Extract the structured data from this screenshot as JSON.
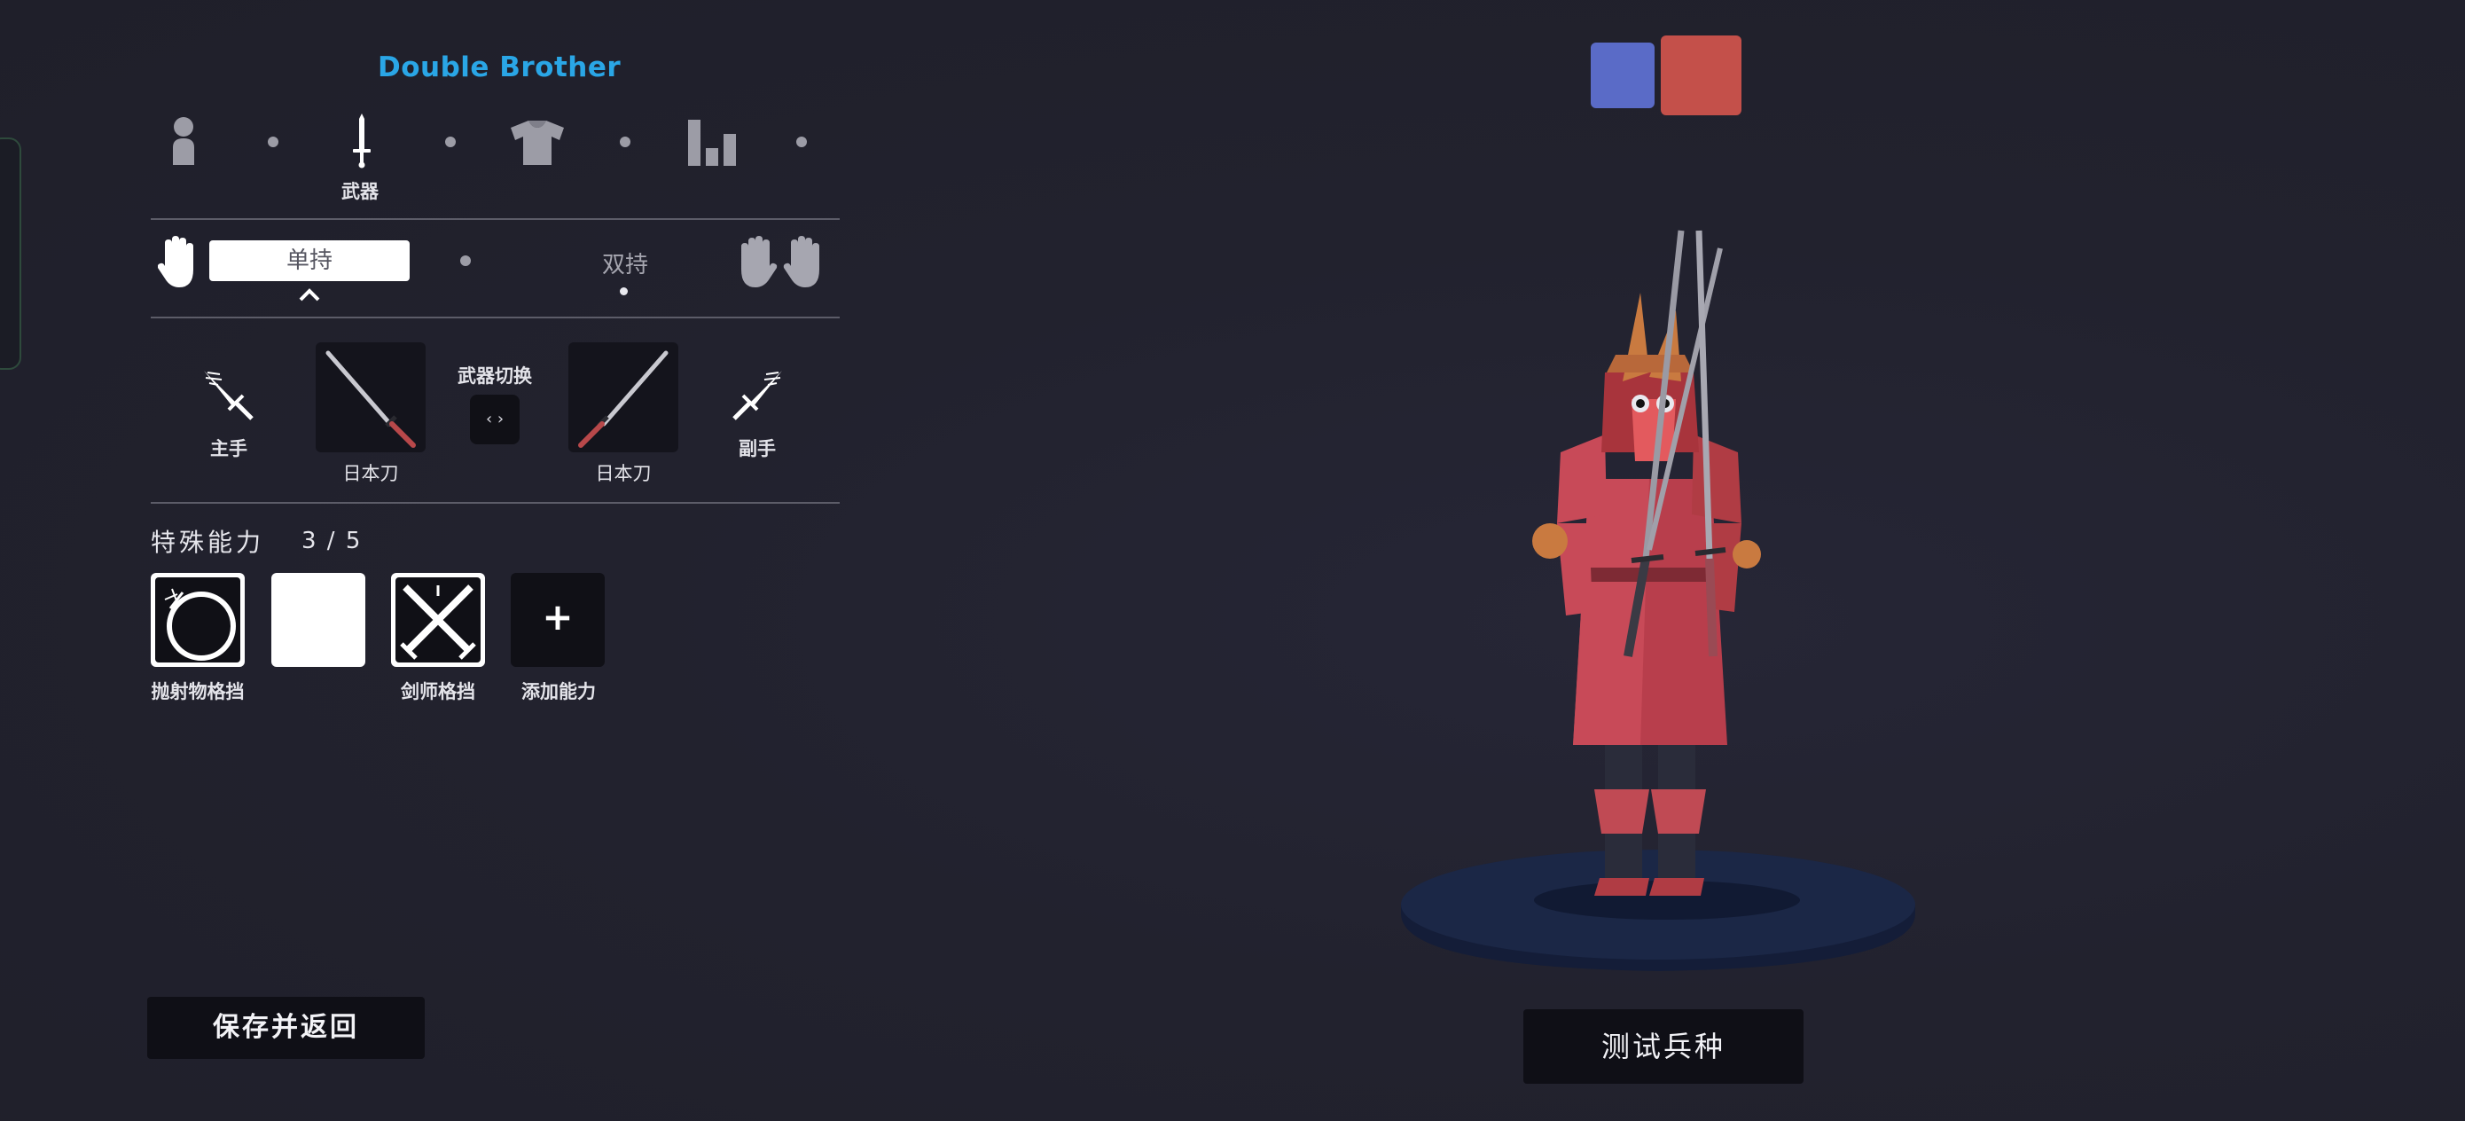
{
  "unit_name": "Double Brother",
  "steps": [
    {
      "icon": "body-icon",
      "label": ""
    },
    {
      "icon": "sword-icon",
      "label": "武器"
    },
    {
      "icon": "shirt-icon",
      "label": ""
    },
    {
      "icon": "stats-icon",
      "label": ""
    }
  ],
  "grip": {
    "single_label": "单持",
    "dual_label": "双持",
    "selected": "单持"
  },
  "weapons": {
    "main_hand_label": "主手",
    "off_hand_label": "副手",
    "main_weapon_name": "日本刀",
    "off_weapon_name": "日本刀",
    "swap_label": "武器切换",
    "swap_glyph": "‹ ›"
  },
  "abilities": {
    "title": "特殊能力",
    "count": "3 / 5",
    "items": [
      {
        "icon": "projectile-block-icon",
        "label": "抛射物格挡"
      },
      {
        "icon": "blank-ability-icon",
        "label": ""
      },
      {
        "icon": "swordmaster-parry-icon",
        "label": "剑师格挡"
      },
      {
        "icon": "plus-icon",
        "label": "添加能力",
        "glyph": "+"
      }
    ]
  },
  "buttons": {
    "save_return": "保存并返回",
    "test_unit": "测试兵种"
  },
  "team_colors": {
    "blue": "#5a6bc7",
    "red": "#c4504a"
  },
  "colors": {
    "accent": "#2aa6e6",
    "background": "#21212d"
  }
}
